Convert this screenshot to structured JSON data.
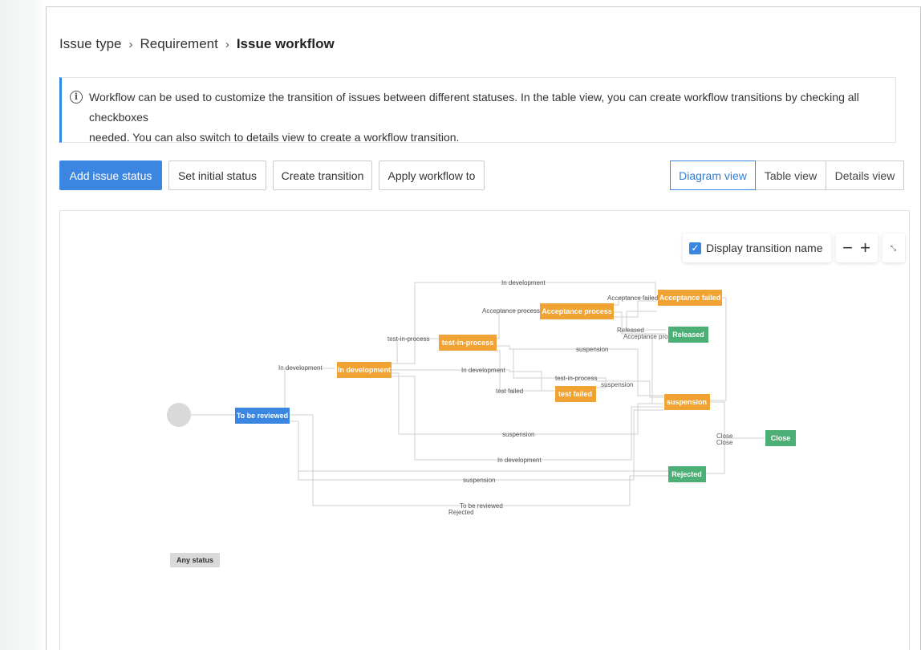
{
  "breadcrumb": {
    "items": [
      "Issue type",
      "Requirement"
    ],
    "current": "Issue workflow"
  },
  "info": {
    "line1": "Workflow can be used to customize the transition of issues between different statuses. In the table view, you can create workflow transitions by checking all checkboxes",
    "line2": "needed. You can also switch to details view to create a workflow transition."
  },
  "toolbar": {
    "add_status": "Add issue status",
    "set_initial": "Set initial status",
    "create_transition": "Create transition",
    "apply_workflow": "Apply workflow to"
  },
  "views": {
    "diagram": "Diagram view",
    "table": "Table view",
    "details": "Details view",
    "active": "diagram"
  },
  "diagram": {
    "display_transition_name": "Display transition name",
    "display_checked": true,
    "zoom_out": "−",
    "zoom_in": "+",
    "nodes": {
      "to_be_reviewed": "To be reviewed",
      "in_development": "In development",
      "test_in_process": "test-in-process",
      "acceptance_process": "Acceptance process",
      "acceptance_failed": "Acceptance failed",
      "released": "Released",
      "test_failed": "test failed",
      "suspension": "suspension",
      "close": "Close",
      "rejected": "Rejected",
      "any_status": "Any status"
    },
    "edge_labels": {
      "in_development": "In development",
      "test_in_process": "test-in-process",
      "acceptance_process": "Acceptance process",
      "acceptance_failed": "Acceptance failed",
      "released": "Released",
      "suspension": "suspension",
      "test_failed": "test failed",
      "close": "Close",
      "to_be_reviewed": "To be reviewed",
      "rejected": "Rejected"
    },
    "colors": {
      "blue": "#3b86e0",
      "orange": "#f0a232",
      "green": "#4caf75",
      "edge": "#c8c8c8"
    }
  }
}
